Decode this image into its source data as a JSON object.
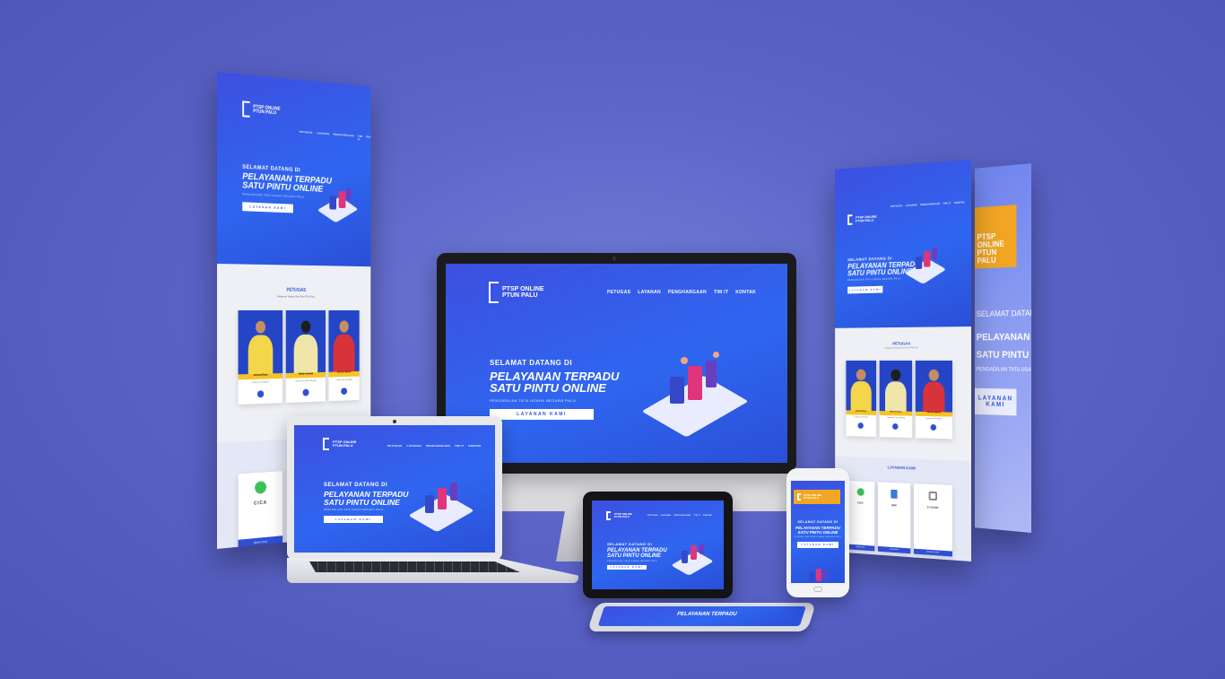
{
  "brand": {
    "line1": "PTSP ONLINE",
    "line2": "PTUN PALU"
  },
  "nav": [
    "PETUGAS",
    "LAYANAN",
    "PENGHARGAAN",
    "TIM IT",
    "KONTAK"
  ],
  "hero": {
    "welcome": "SELAMAT DATANG DI",
    "title_line1": "PELAYANAN TERPADU",
    "title_line2": "SATU PINTU ONLINE",
    "subtitle": "PENGADILAN TATA USAHA NEGARA PALU",
    "cta": "LAYANAN KAMI"
  },
  "petugas": {
    "title": "PETUGAS",
    "subtitle": "Pelayanan Terpadu Satu Pintu PTUN Palu",
    "cards": [
      {
        "name": "Achmad Riyan",
        "role": "Layanan Via Telepon",
        "color": "#f3d64a"
      },
      {
        "name": "Wiwik Ismawati",
        "role": "Layanan Via Zoom Meeting",
        "color": "#efe5a8"
      },
      {
        "name": "Riki Sutri Affandi",
        "role": "Layanan Via WhatsApp",
        "color": "#d8323a"
      }
    ]
  },
  "layanan": {
    "title": "LAYANAN KAMI",
    "items": [
      {
        "name": "CICA",
        "button": "BUKA CICA"
      },
      {
        "name": "SIPP",
        "button": "BUKA SIPP"
      },
      {
        "name": "E-COURT",
        "button": "BUKA E-COURT"
      }
    ]
  },
  "colors": {
    "background": "#5a63c6",
    "primary": "#2f66f0",
    "accent": "#f7c325"
  }
}
